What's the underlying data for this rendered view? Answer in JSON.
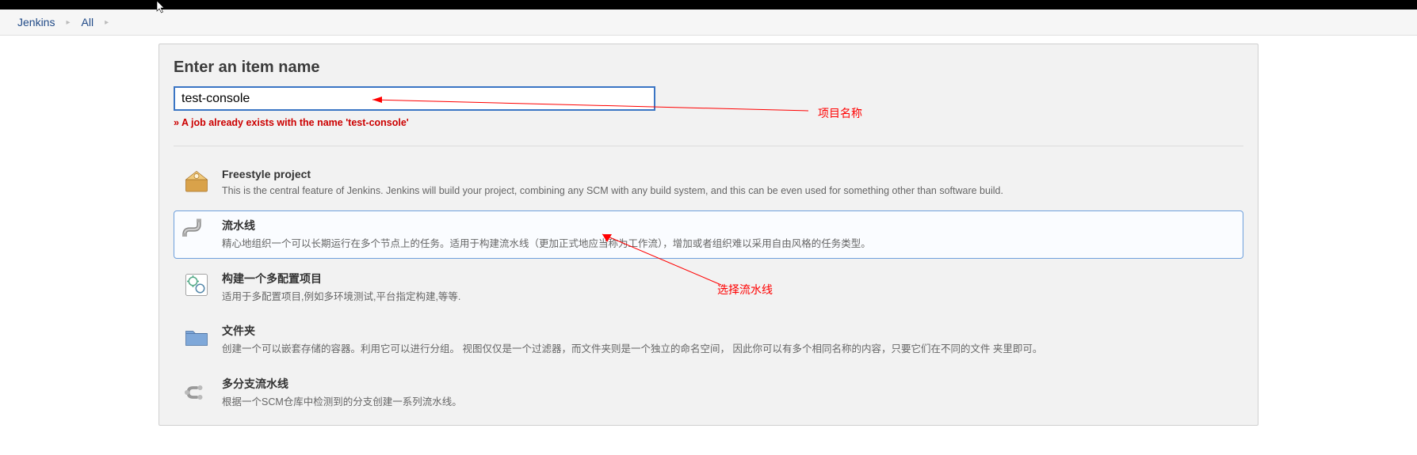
{
  "breadcrumb": {
    "items": [
      {
        "label": "Jenkins"
      },
      {
        "label": "All"
      }
    ]
  },
  "header": {
    "title": "Enter an item name"
  },
  "name_input": {
    "value": "test-console",
    "placeholder": ""
  },
  "validation": {
    "message": "» A job already exists with the name 'test-console'"
  },
  "item_types": [
    {
      "id": "freestyle",
      "label": "Freestyle project",
      "desc": "This is the central feature of Jenkins. Jenkins will build your project, combining any SCM with any build system, and this can be even used for something other than software build.",
      "selected": false
    },
    {
      "id": "pipeline",
      "label": "流水线",
      "desc": "精心地组织一个可以长期运行在多个节点上的任务。适用于构建流水线（更加正式地应当称为工作流），增加或者组织难以采用自由风格的任务类型。",
      "selected": true
    },
    {
      "id": "multiconfig",
      "label": "构建一个多配置项目",
      "desc": "适用于多配置项目,例如多环境测试,平台指定构建,等等.",
      "selected": false
    },
    {
      "id": "folder",
      "label": "文件夹",
      "desc": "创建一个可以嵌套存储的容器。利用它可以进行分组。 视图仅仅是一个过滤器，而文件夹则是一个独立的命名空间， 因此你可以有多个相同名称的内容，只要它们在不同的文件 夹里即可。",
      "selected": false
    },
    {
      "id": "multibranch",
      "label": "多分支流水线",
      "desc": "根据一个SCM仓库中检测到的分支创建一系列流水线。",
      "selected": false
    }
  ],
  "annotations": {
    "name_label": "项目名称",
    "select_label": "选择流水线"
  }
}
